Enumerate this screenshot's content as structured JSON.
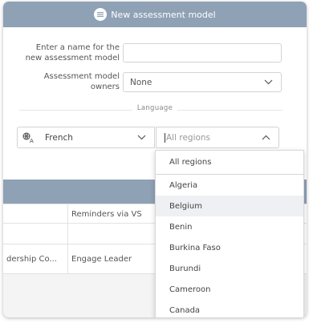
{
  "modal": {
    "title": "New assessment model",
    "name_label_line1": "Enter a name for the",
    "name_label_line2": "new assessment model",
    "name_value": "",
    "owners_label_line1": "Assessment model",
    "owners_label_line2": "owners",
    "owners_value": "None",
    "language_section": "Language",
    "language_value": "French",
    "region_placeholder": "All regions"
  },
  "table": {
    "rows": [
      [
        "",
        "Reminders via VS"
      ],
      [
        "",
        ""
      ],
      [
        "dership Co...",
        "Engage Leader"
      ]
    ]
  },
  "region_dropdown": {
    "options": [
      "All regions",
      "Algeria",
      "Belgium",
      "Benin",
      "Burkina Faso",
      "Burundi",
      "Cameroon",
      "Canada"
    ],
    "highlighted": "Belgium"
  },
  "colors": {
    "header": "#8fa1b5"
  }
}
